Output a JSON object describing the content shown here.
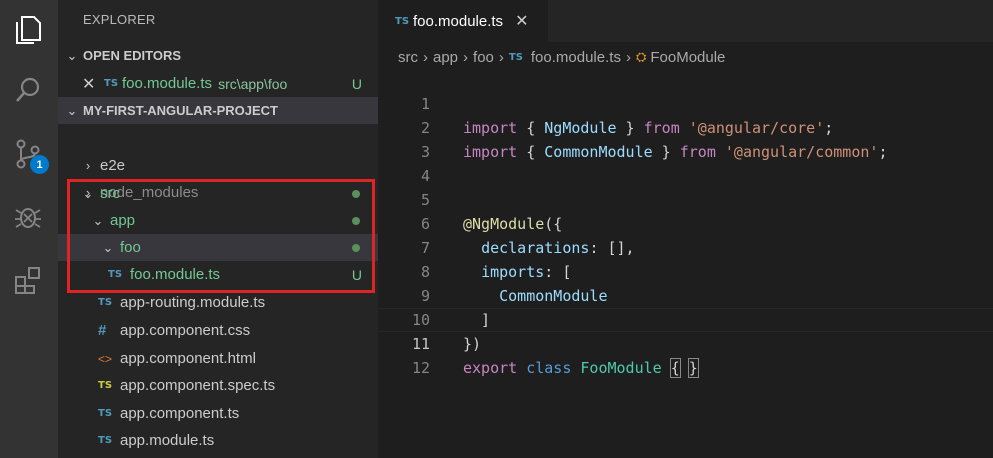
{
  "sidebar": {
    "title": "EXPLORER",
    "open_editors_label": "OPEN EDITORS",
    "open_editor": {
      "name": "foo.module.ts",
      "path": "src\\app\\foo",
      "status": "U"
    },
    "project_label": "MY-FIRST-ANGULAR-PROJECT",
    "tree": [
      {
        "label": "e2e"
      },
      {
        "label": "node_modules"
      },
      {
        "label": "src"
      },
      {
        "label": "app"
      },
      {
        "label": "foo"
      },
      {
        "label": "foo.module.ts",
        "status": "U"
      },
      {
        "label": "app-routing.module.ts"
      },
      {
        "label": "app.component.css"
      },
      {
        "label": "app.component.html"
      },
      {
        "label": "app.component.spec.ts"
      },
      {
        "label": "app.component.ts"
      },
      {
        "label": "app.module.ts"
      }
    ]
  },
  "activity": {
    "scm_badge": "1"
  },
  "icons": {
    "ts": "TS",
    "css": "#",
    "html": "<>"
  },
  "editor": {
    "tab_label": "foo.module.ts",
    "breadcrumb": [
      "src",
      "app",
      "foo",
      "foo.module.ts",
      "FooModule"
    ],
    "line_numbers": [
      "1",
      "2",
      "3",
      "4",
      "5",
      "6",
      "7",
      "8",
      "9",
      "10",
      "11",
      "12"
    ],
    "tokens": {
      "import": "import",
      "from": "from",
      "export": "export",
      "class": "class",
      "NgModule": "NgModule",
      "CommonModule": "CommonModule",
      "FooModule": "FooModule",
      "core": "'@angular/core'",
      "common": "'@angular/common'",
      "decorator": "@NgModule",
      "declarations": "declarations",
      "imports": "imports"
    }
  },
  "colors": {
    "accent": "#007acc",
    "untracked": "#73c991",
    "highlight_box": "#e02424"
  }
}
